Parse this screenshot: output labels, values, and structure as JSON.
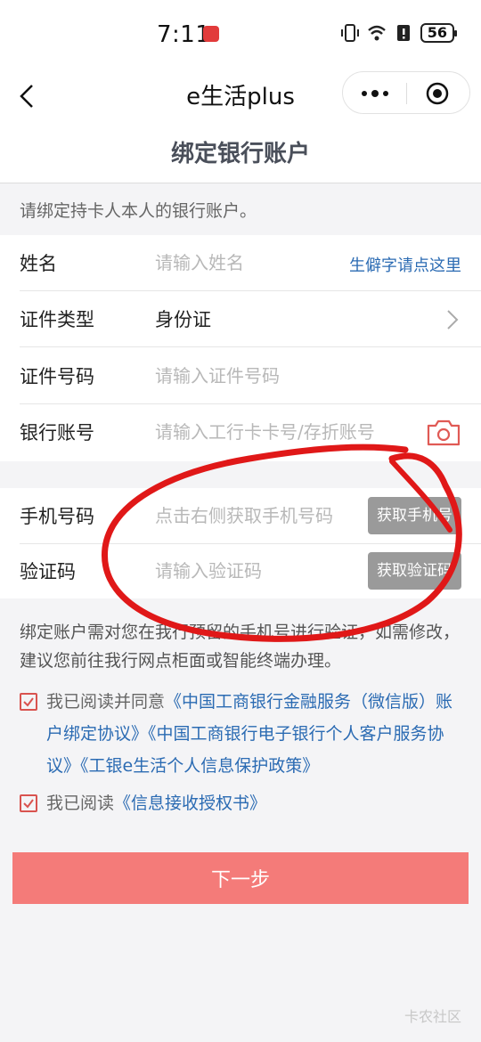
{
  "status_bar": {
    "time": "7:11",
    "battery": "56"
  },
  "nav": {
    "title": "e生活plus"
  },
  "page": {
    "title": "绑定银行账户",
    "hint": "请绑定持卡人本人的银行账户。"
  },
  "form": {
    "name": {
      "label": "姓名",
      "placeholder": "请输入姓名",
      "link": "生僻字请点这里"
    },
    "id_type": {
      "label": "证件类型",
      "value": "身份证"
    },
    "id_number": {
      "label": "证件号码",
      "placeholder": "请输入证件号码"
    },
    "bank_account": {
      "label": "银行账号",
      "placeholder": "请输入工行卡卡号/存折账号"
    },
    "phone": {
      "label": "手机号码",
      "placeholder": "点击右侧获取手机号码",
      "button": "获取手机号"
    },
    "code": {
      "label": "验证码",
      "placeholder": "请输入验证码",
      "button": "获取验证码"
    }
  },
  "notice": "绑定账户需对您在我行预留的手机号进行验证，如需修改，建议您前往我行网点柜面或智能终端办理。",
  "agreements": {
    "first_prefix": "我已阅读并同意",
    "first_links": "《中国工商银行金融服务（微信版）账户绑定协议》《中国工商银行电子银行个人客户服务协议》《工银e生活个人信息保护政策》",
    "second_prefix": "我已阅读",
    "second_link": "《信息接收授权书》"
  },
  "next_button": "下一步",
  "watermark": "卡农社区",
  "colors": {
    "accent_red": "#f47b79",
    "link_blue": "#2b6bb3",
    "scribble_red": "#e01818"
  }
}
